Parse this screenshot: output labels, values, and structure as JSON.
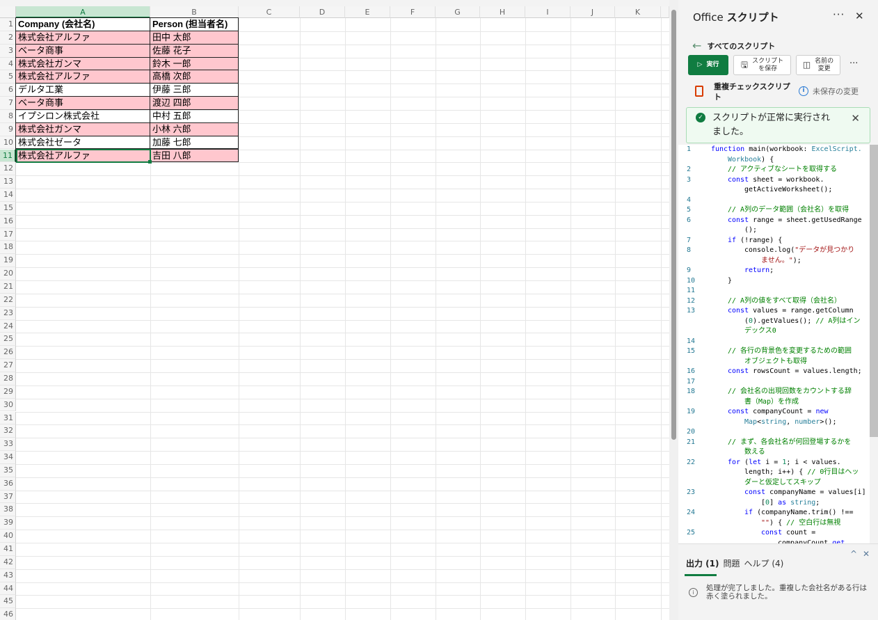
{
  "sheet": {
    "columns": [
      "A",
      "B",
      "C",
      "D",
      "E",
      "F",
      "G",
      "H",
      "I",
      "J",
      "K"
    ],
    "row_count": 46,
    "header": [
      "Company (会社名)",
      "Person (担当者名)"
    ],
    "rows": [
      {
        "company": "株式会社アルファ",
        "person": "田中 太郎",
        "dup": true
      },
      {
        "company": "ベータ商事",
        "person": "佐藤 花子",
        "dup": true
      },
      {
        "company": "株式会社ガンマ",
        "person": "鈴木 一郎",
        "dup": true
      },
      {
        "company": "株式会社アルファ",
        "person": "高橋 次郎",
        "dup": true
      },
      {
        "company": "デルタ工業",
        "person": "伊藤 三郎",
        "dup": false
      },
      {
        "company": "ベータ商事",
        "person": "渡辺 四郎",
        "dup": true
      },
      {
        "company": "イプシロン株式会社",
        "person": "中村 五郎",
        "dup": false
      },
      {
        "company": "株式会社ガンマ",
        "person": "小林 六郎",
        "dup": true
      },
      {
        "company": "株式会社ゼータ",
        "person": "加藤 七郎",
        "dup": false
      },
      {
        "company": "株式会社アルファ",
        "person": "吉田 八郎",
        "dup": true
      }
    ],
    "dup_color": "#ffc7ce"
  },
  "panel": {
    "title_prefix": "Office",
    "title_main": "スクリプト",
    "back_label": "すべてのスクリプト",
    "run_label": "実行",
    "save_label_1": "スクリプト",
    "save_label_2": "を保存",
    "rename_label_1": "名前の",
    "rename_label_2": "変更",
    "script_name": "重複チェックスクリプト",
    "unsaved_label": "未保存の変更",
    "toast_message": "スクリプトが正常に実行されました。",
    "accent": "#107c41"
  },
  "code": [
    {
      "n": "1",
      "i": 0,
      "p": [
        [
          "k",
          "function "
        ],
        [
          "p",
          "main(workbook: "
        ],
        [
          "ty",
          "ExcelScript."
        ]
      ]
    },
    {
      "n": "",
      "i": 1,
      "p": [
        [
          "ty",
          "Workbook"
        ],
        [
          "p",
          ") {"
        ]
      ]
    },
    {
      "n": "2",
      "i": 1,
      "p": [
        [
          "cm",
          "// アクティブなシートを取得する"
        ]
      ]
    },
    {
      "n": "3",
      "i": 1,
      "p": [
        [
          "k",
          "const "
        ],
        [
          "p",
          "sheet = workbook."
        ]
      ]
    },
    {
      "n": "",
      "i": 2,
      "p": [
        [
          "p",
          "getActiveWorksheet();"
        ]
      ]
    },
    {
      "n": "4",
      "i": 0,
      "p": []
    },
    {
      "n": "5",
      "i": 1,
      "p": [
        [
          "cm",
          "// A列のデータ範囲（会社名）を取得"
        ]
      ]
    },
    {
      "n": "6",
      "i": 1,
      "p": [
        [
          "k",
          "const "
        ],
        [
          "p",
          "range = sheet.getUsedRange"
        ]
      ]
    },
    {
      "n": "",
      "i": 2,
      "p": [
        [
          "p",
          "();"
        ]
      ]
    },
    {
      "n": "7",
      "i": 1,
      "p": [
        [
          "k",
          "if "
        ],
        [
          "p",
          "(!range) {"
        ]
      ]
    },
    {
      "n": "8",
      "i": 2,
      "p": [
        [
          "p",
          "console.log("
        ],
        [
          "s",
          "\"データが見つかり"
        ]
      ]
    },
    {
      "n": "",
      "i": 3,
      "p": [
        [
          "s",
          "ません。\""
        ],
        [
          "p",
          ");"
        ]
      ]
    },
    {
      "n": "9",
      "i": 2,
      "p": [
        [
          "k",
          "return"
        ],
        [
          "p",
          ";"
        ]
      ]
    },
    {
      "n": "10",
      "i": 1,
      "p": [
        [
          "p",
          "}"
        ]
      ]
    },
    {
      "n": "11",
      "i": 0,
      "p": []
    },
    {
      "n": "12",
      "i": 1,
      "p": [
        [
          "cm",
          "// A列の値をすべて取得（会社名）"
        ]
      ]
    },
    {
      "n": "13",
      "i": 1,
      "p": [
        [
          "k",
          "const "
        ],
        [
          "p",
          "values = range.getColumn"
        ]
      ]
    },
    {
      "n": "",
      "i": 2,
      "p": [
        [
          "p",
          "("
        ],
        [
          "n",
          "0"
        ],
        [
          "p",
          ").getValues(); "
        ],
        [
          "cm",
          "// A列はイン"
        ]
      ]
    },
    {
      "n": "",
      "i": 2,
      "p": [
        [
          "cm",
          "デックス0"
        ]
      ]
    },
    {
      "n": "14",
      "i": 0,
      "p": []
    },
    {
      "n": "15",
      "i": 1,
      "p": [
        [
          "cm",
          "// 各行の背景色を変更するための範囲"
        ]
      ]
    },
    {
      "n": "",
      "i": 2,
      "p": [
        [
          "cm",
          "オブジェクトも取得"
        ]
      ]
    },
    {
      "n": "16",
      "i": 1,
      "p": [
        [
          "k",
          "const "
        ],
        [
          "p",
          "rowsCount = values.length;"
        ]
      ]
    },
    {
      "n": "17",
      "i": 0,
      "p": []
    },
    {
      "n": "18",
      "i": 1,
      "p": [
        [
          "cm",
          "// 会社名の出現回数をカウントする辞"
        ]
      ]
    },
    {
      "n": "",
      "i": 2,
      "p": [
        [
          "cm",
          "書（Map）を作成"
        ]
      ]
    },
    {
      "n": "19",
      "i": 1,
      "p": [
        [
          "k",
          "const "
        ],
        [
          "p",
          "companyCount = "
        ],
        [
          "k",
          "new"
        ]
      ]
    },
    {
      "n": "",
      "i": 2,
      "p": [
        [
          "ty",
          "Map"
        ],
        [
          "p",
          "<"
        ],
        [
          "ty",
          "string"
        ],
        [
          "p",
          ", "
        ],
        [
          "ty",
          "number"
        ],
        [
          "p",
          ">();"
        ]
      ]
    },
    {
      "n": "20",
      "i": 0,
      "p": []
    },
    {
      "n": "21",
      "i": 1,
      "p": [
        [
          "cm",
          "// まず、各会社名が何回登場するかを"
        ]
      ]
    },
    {
      "n": "",
      "i": 2,
      "p": [
        [
          "cm",
          "数える"
        ]
      ]
    },
    {
      "n": "22",
      "i": 1,
      "p": [
        [
          "k",
          "for "
        ],
        [
          "p",
          "("
        ],
        [
          "k",
          "let "
        ],
        [
          "p",
          "i = "
        ],
        [
          "n",
          "1"
        ],
        [
          "p",
          "; i < values."
        ]
      ]
    },
    {
      "n": "",
      "i": 2,
      "p": [
        [
          "p",
          "length; i++) { "
        ],
        [
          "cm",
          "// 0行目はヘッ"
        ]
      ]
    },
    {
      "n": "",
      "i": 2,
      "p": [
        [
          "cm",
          "ダーと仮定してスキップ"
        ]
      ]
    },
    {
      "n": "23",
      "i": 2,
      "p": [
        [
          "k",
          "const "
        ],
        [
          "p",
          "companyName = values[i]"
        ]
      ]
    },
    {
      "n": "",
      "i": 3,
      "p": [
        [
          "p",
          "["
        ],
        [
          "n",
          "0"
        ],
        [
          "p",
          "] "
        ],
        [
          "k",
          "as "
        ],
        [
          "ty",
          "string"
        ],
        [
          "p",
          ";"
        ]
      ]
    },
    {
      "n": "24",
      "i": 2,
      "p": [
        [
          "k",
          "if "
        ],
        [
          "p",
          "(companyName.trim() !=="
        ]
      ]
    },
    {
      "n": "",
      "i": 3,
      "p": [
        [
          "s",
          "\"\""
        ],
        [
          "p",
          ") { "
        ],
        [
          "cm",
          "// 空白行は無視"
        ]
      ]
    },
    {
      "n": "25",
      "i": 3,
      "p": [
        [
          "k",
          "const "
        ],
        [
          "p",
          "count ="
        ]
      ]
    },
    {
      "n": "",
      "i": 4,
      "p": [
        [
          "p",
          "companyCount."
        ],
        [
          "k",
          "get"
        ]
      ]
    }
  ],
  "output": {
    "tab_output": "出力 (1)",
    "tab_problems": "問題",
    "tab_help": "ヘルプ (4)",
    "message": "処理が完了しました。重複した会社名がある行は赤く塗られました。"
  }
}
